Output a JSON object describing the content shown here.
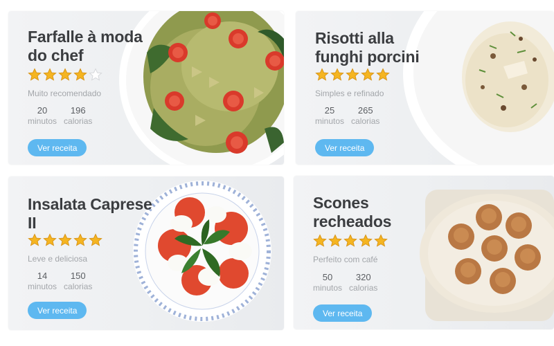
{
  "cards": [
    {
      "title": "Farfalle à moda do chef",
      "rating": 4,
      "max_rating": 5,
      "subtitle": "Muito recomendado",
      "time_value": "20",
      "time_unit": "minutos",
      "calories_value": "196",
      "calories_unit": "calorias",
      "button_label": "Ver receita"
    },
    {
      "title": "Risotti alla funghi porcini",
      "rating": 5,
      "max_rating": 5,
      "subtitle": "Simples e refinado",
      "time_value": "25",
      "time_unit": "minutos",
      "calories_value": "265",
      "calories_unit": "calorias",
      "button_label": "Ver receita"
    },
    {
      "title": "Insalata Caprese II",
      "rating": 5,
      "max_rating": 5,
      "subtitle": "Leve e deliciosa",
      "time_value": "14",
      "time_unit": "minutos",
      "calories_value": "150",
      "calories_unit": "calorias",
      "button_label": "Ver receita"
    },
    {
      "title": "Scones recheados",
      "rating": 5,
      "max_rating": 5,
      "subtitle": "Perfeito com café",
      "time_value": "50",
      "time_unit": "minutos",
      "calories_value": "320",
      "calories_unit": "calorias",
      "button_label": "Ver receita"
    }
  ],
  "colors": {
    "button": "#5eb8f0",
    "star_fill": "#f5b521",
    "star_empty": "#d6d8db",
    "title": "#3b3d40",
    "muted": "#a3a6aa"
  },
  "icons": {
    "star": "star-icon",
    "star_empty": "star-empty-icon"
  }
}
